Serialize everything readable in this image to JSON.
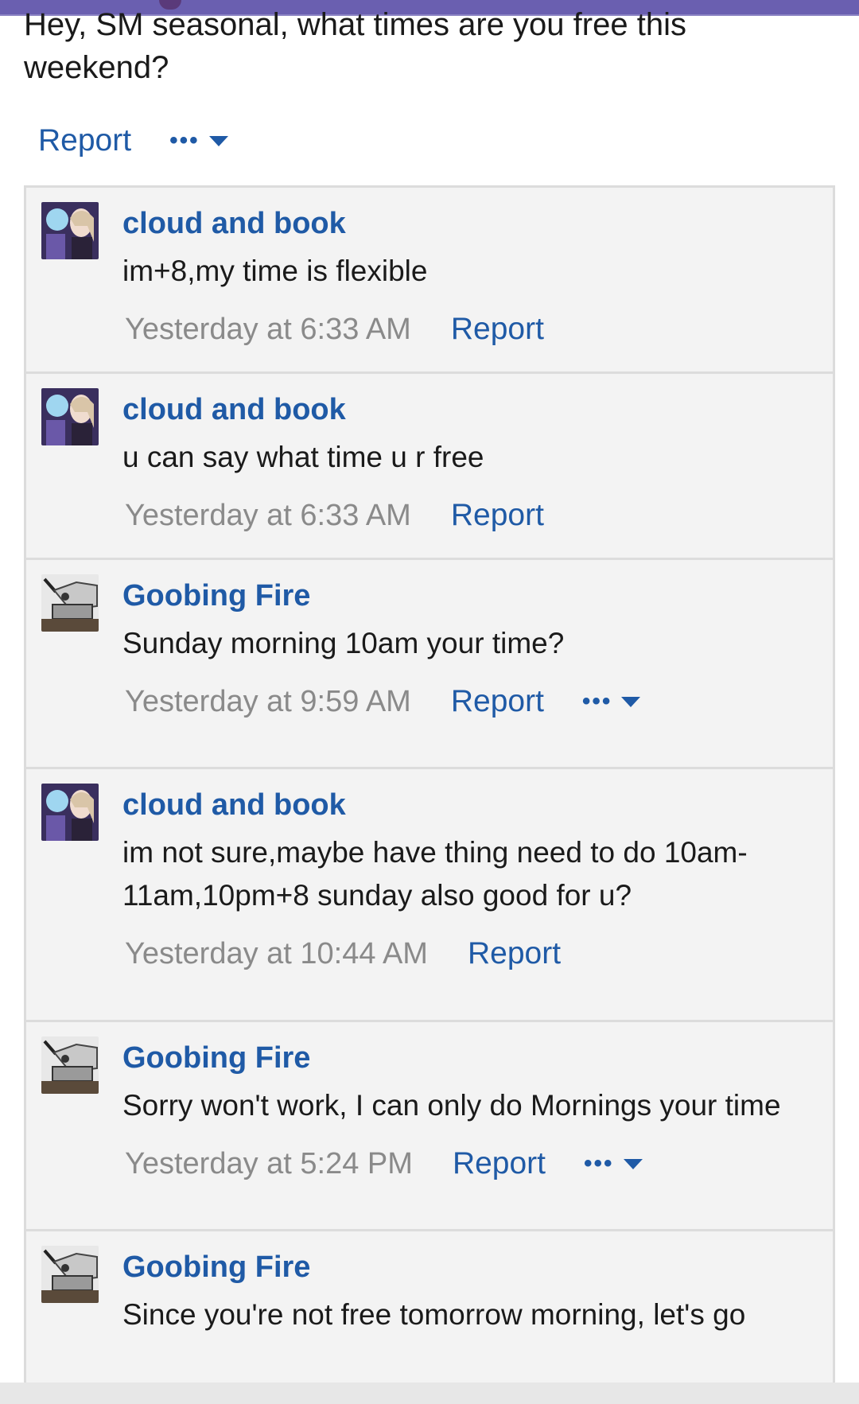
{
  "post": {
    "text": "Hey, SM seasonal, what times are you free this\nweekend?",
    "report_label": "Report",
    "more_label": "•••"
  },
  "replies": [
    {
      "author": "cloud and book",
      "avatar_icon": "anime-avatar-icon",
      "message": "im+8,my time is flexible",
      "time": "Yesterday at 6:33 AM",
      "report_label": "Report",
      "has_more": false
    },
    {
      "author": "cloud and book",
      "avatar_icon": "anime-avatar-icon",
      "message": "u can say what time u r free",
      "time": "Yesterday at 6:33 AM",
      "report_label": "Report",
      "has_more": false
    },
    {
      "author": "Goobing Fire",
      "avatar_icon": "robot-avatar-icon",
      "message": "Sunday morning 10am your time?",
      "time": "Yesterday at 9:59 AM",
      "report_label": "Report",
      "has_more": true,
      "more_label": "•••"
    },
    {
      "author": "cloud and book",
      "avatar_icon": "anime-avatar-icon",
      "message": "im not sure,maybe have thing need to do 10am-11am,10pm+8 sunday also good for u?",
      "time": "Yesterday at 10:44 AM",
      "report_label": "Report",
      "has_more": false
    },
    {
      "author": "Goobing Fire",
      "avatar_icon": "robot-avatar-icon",
      "message": "Sorry won't work, I can only do Mornings your time",
      "time": "Yesterday at 5:24 PM",
      "report_label": "Report",
      "has_more": true,
      "more_label": "•••"
    },
    {
      "author": "Goobing Fire",
      "avatar_icon": "robot-avatar-icon",
      "message": "Since you're not free tomorrow morning, let's go",
      "time": "",
      "report_label": "",
      "has_more": false
    }
  ],
  "colors": {
    "link": "#1f5aa6",
    "timestamp": "#8a8a8a",
    "panel": "#f3f3f3",
    "topbar": "#6a5fb0"
  }
}
